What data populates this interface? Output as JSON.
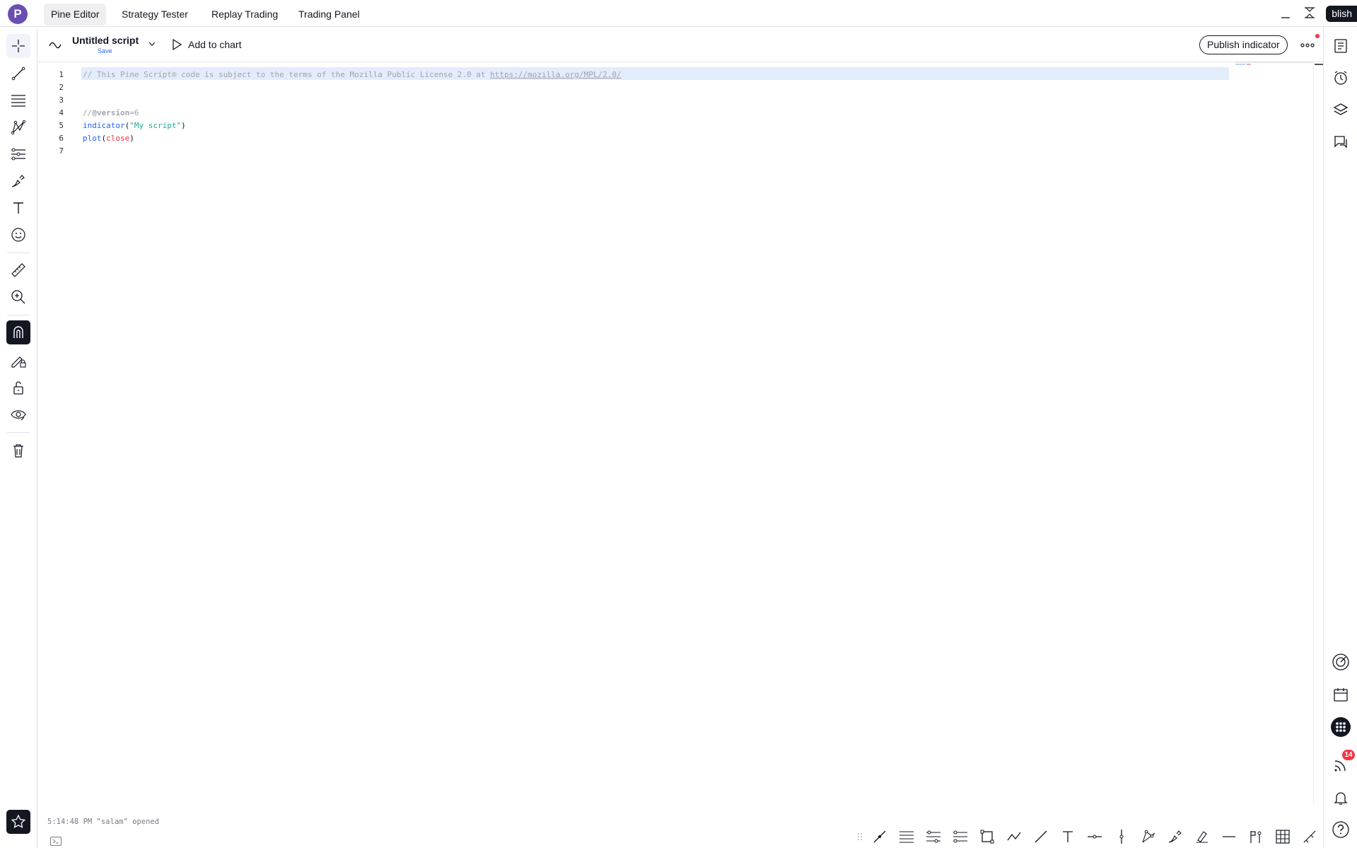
{
  "user": {
    "avatar_letter": "P"
  },
  "tabs": [
    {
      "label": "Pine Editor",
      "active": true
    },
    {
      "label": "Strategy Tester",
      "active": false
    },
    {
      "label": "Replay Trading",
      "active": false
    },
    {
      "label": "Trading Panel",
      "active": false
    }
  ],
  "topbar": {
    "publish_label": "blish"
  },
  "editor": {
    "script_name": "Untitled script",
    "save_label": "Save",
    "add_to_chart_label": "Add to chart",
    "publish_indicator_label": "Publish indicator"
  },
  "code": {
    "line_numbers": [
      "1",
      "2",
      "3",
      "4",
      "5",
      "6",
      "7"
    ],
    "line1_comment": "// This Pine Script® code is subject to the terms of the Mozilla Public License 2.0 at ",
    "line1_url": "https://mozilla.org/MPL/2.0/",
    "line4_prefix": "//",
    "line4_annotation": "@version",
    "line4_value": "=6",
    "line5_fn": "indicator",
    "line5_open": "(",
    "line5_str": "\"My script\"",
    "line5_close": ")",
    "line6_fn": "plot",
    "line6_open": "(",
    "line6_arg": "close",
    "line6_close": ")"
  },
  "status": {
    "message": "5:14:48 PM  \"salam\" opened"
  },
  "right_toolbar": {
    "notifications_count": "14"
  },
  "colors": {
    "accent": "#2962ff",
    "keyword": "#2962ff",
    "string": "#22ab94",
    "variable": "#f23645",
    "comment": "#a0a4ad",
    "dark": "#131722",
    "badge": "#f23645"
  },
  "icons": {
    "left": [
      "crosshair-icon",
      "trend-line-icon",
      "fib-retracement-icon",
      "pattern-icon",
      "prediction-icon",
      "brush-icon",
      "text-icon",
      "emoji-icon",
      "ruler-icon",
      "zoom-in-icon",
      "magnet-icon",
      "lock-drawing-icon",
      "unlock-icon",
      "eye-icon",
      "trash-icon",
      "favorites-star-icon"
    ],
    "right": [
      "watchlist-icon",
      "alerts-clock-icon",
      "layers-icon",
      "chat-icon",
      "target-icon",
      "calendar-icon",
      "apps-grid-icon",
      "feed-icon",
      "bell-icon",
      "help-icon"
    ]
  }
}
